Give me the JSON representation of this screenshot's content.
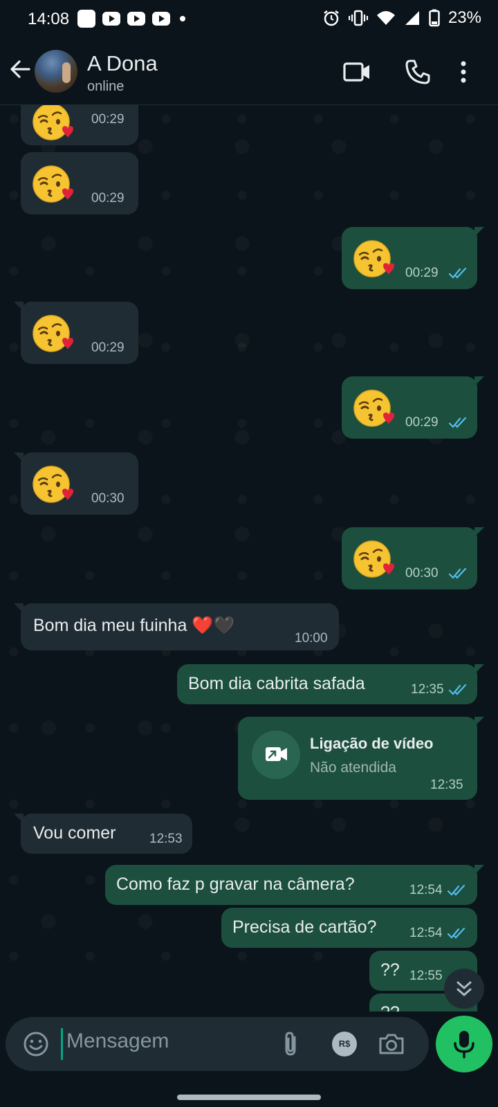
{
  "status_bar": {
    "time": "14:08",
    "battery": "23%"
  },
  "header": {
    "contact_name": "A Dona",
    "contact_status": "online"
  },
  "messages": [
    {
      "direction": "in",
      "content": "😘",
      "time": "00:29"
    },
    {
      "direction": "in",
      "content": "😘",
      "time": "00:29"
    },
    {
      "direction": "out",
      "content": "😘",
      "time": "00:29",
      "status": "read"
    },
    {
      "direction": "in",
      "content": "😘",
      "time": "00:29"
    },
    {
      "direction": "out",
      "content": "😘",
      "time": "00:29",
      "status": "read"
    },
    {
      "direction": "in",
      "content": "😘",
      "time": "00:30"
    },
    {
      "direction": "out",
      "content": "😘",
      "time": "00:30",
      "status": "read"
    },
    {
      "direction": "in",
      "content": "Bom dia meu fuinha ❤️🖤",
      "time": "10:00"
    },
    {
      "direction": "out",
      "content": "Bom dia cabrita safada",
      "time": "12:35",
      "status": "read"
    },
    {
      "direction": "out",
      "type": "call",
      "title": "Ligação de vídeo",
      "subtitle": "Não atendida",
      "time": "12:35"
    },
    {
      "direction": "in",
      "content": "Vou comer",
      "time": "12:53"
    },
    {
      "direction": "out",
      "content": "Como faz p gravar na câmera?",
      "time": "12:54",
      "status": "read"
    },
    {
      "direction": "out",
      "content": "Precisa de cartão?",
      "time": "12:54",
      "status": "read"
    },
    {
      "direction": "out",
      "content": "??",
      "time": "12:55",
      "status": "read"
    },
    {
      "direction": "out",
      "content": "??",
      "time": "",
      "status": "read"
    }
  ],
  "composer": {
    "placeholder": "Mensagem",
    "payment_badge": "R$"
  },
  "colors": {
    "accent": "#21c063",
    "outgoing_bubble": "#1c4f3e",
    "incoming_bubble": "#202c33",
    "read_ticks": "#53bdeb"
  },
  "icons": [
    "back-arrow-icon",
    "video-call-icon",
    "phone-icon",
    "more-options-icon",
    "emoji-icon",
    "attach-icon",
    "payment-icon",
    "camera-icon",
    "mic-icon",
    "scroll-down-icon"
  ]
}
